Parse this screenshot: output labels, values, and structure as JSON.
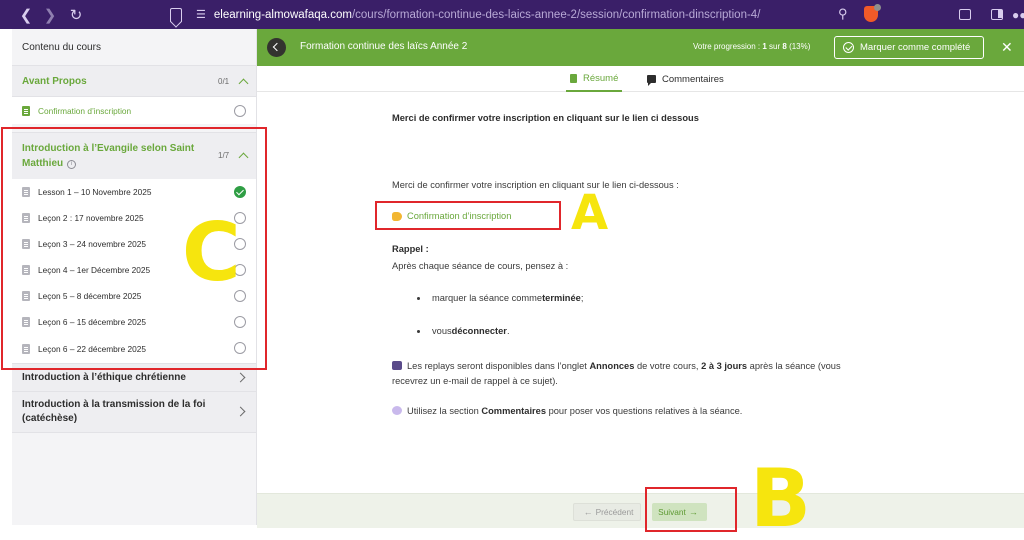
{
  "browser": {
    "url_host": "elearning-almowafaqa.com",
    "url_path": "/cours/formation-continue-des-laics-annee-2/session/confirmation-dinscription-4/"
  },
  "sidebar": {
    "header": "Contenu du cours",
    "sections": [
      {
        "title": "Avant Propos",
        "count": "0/1",
        "lessons": [
          {
            "label": "Confirmation d’inscription",
            "status": "current"
          }
        ]
      },
      {
        "title": "Introduction à l’Evangile selon Saint Matthieu",
        "count": "1/7",
        "info_icon": "info-icon",
        "lessons": [
          {
            "label": "Lesson 1 – 10 Novembre 2025",
            "status": "completed"
          },
          {
            "label": "Leçon 2 : 17 novembre 2025",
            "status": "incomplete"
          },
          {
            "label": "Leçon 3 – 24 novembre 2025",
            "status": "incomplete"
          },
          {
            "label": "Leçon 4 – 1er Décembre 2025",
            "status": "incomplete"
          },
          {
            "label": "Leçon 5 – 8 décembre 2025",
            "status": "incomplete"
          },
          {
            "label": "Leçon 6 – 15 décembre 2025",
            "status": "incomplete"
          },
          {
            "label": "Leçon 6 – 22 décembre 2025",
            "status": "incomplete"
          }
        ]
      },
      {
        "title": "Introduction à l’éthique chrétienne"
      },
      {
        "title": "Introduction à la transmission de la foi (catéchèse)"
      }
    ]
  },
  "course_bar": {
    "title": "Formation continue des laïcs Année 2",
    "progress_prefix": "Votre progression : ",
    "progress_done": "1",
    "progress_mid": " sur ",
    "progress_total": "8",
    "progress_pct": " (13%)",
    "complete_label": "Marquer comme complété"
  },
  "tabs": [
    {
      "label": "Résumé",
      "icon": "document-icon",
      "active": true
    },
    {
      "label": "Commentaires",
      "icon": "comment-icon",
      "active": false
    }
  ],
  "content": {
    "heading": "Merci de confirmer votre inscription en cliquant sur le lien ci dessous",
    "intro": "Merci de confirmer votre inscription en cliquant sur le lien ci-dessous :",
    "link_label": "Confirmation d’inscription",
    "rappel_title": "Rappel :",
    "rappel_text": "Après chaque séance de cours, pensez à :",
    "bullet1_pre": "marquer la séance comme ",
    "bullet1_bold": "terminée",
    "bullet1_post": " ;",
    "bullet2_pre": "vous ",
    "bullet2_bold": "déconnecter",
    "bullet2_post": ".",
    "replay_pre": "Les replays seront disponibles dans l’onglet ",
    "replay_bold1": "Annonces",
    "replay_mid": " de votre cours, ",
    "replay_bold2": "2 à 3 jours",
    "replay_post": " après la séance (vous recevrez un e-mail de rappel à ce sujet).",
    "comment_pre": "Utilisez la section ",
    "comment_bold": "Commentaires",
    "comment_post": " pour poser vos questions relatives à la séance."
  },
  "footer": {
    "prev_label": "Précédent",
    "next_label": "Suivant"
  },
  "annotations": {
    "letter_a": "A",
    "letter_b": "B",
    "letter_c": "C",
    "box_color": "#e0262b",
    "letter_color": "#f6e50e"
  },
  "colors": {
    "accent_green": "#6aa83c",
    "browser_purple": "#3a1f68",
    "completed_check": "#2f9e44"
  }
}
